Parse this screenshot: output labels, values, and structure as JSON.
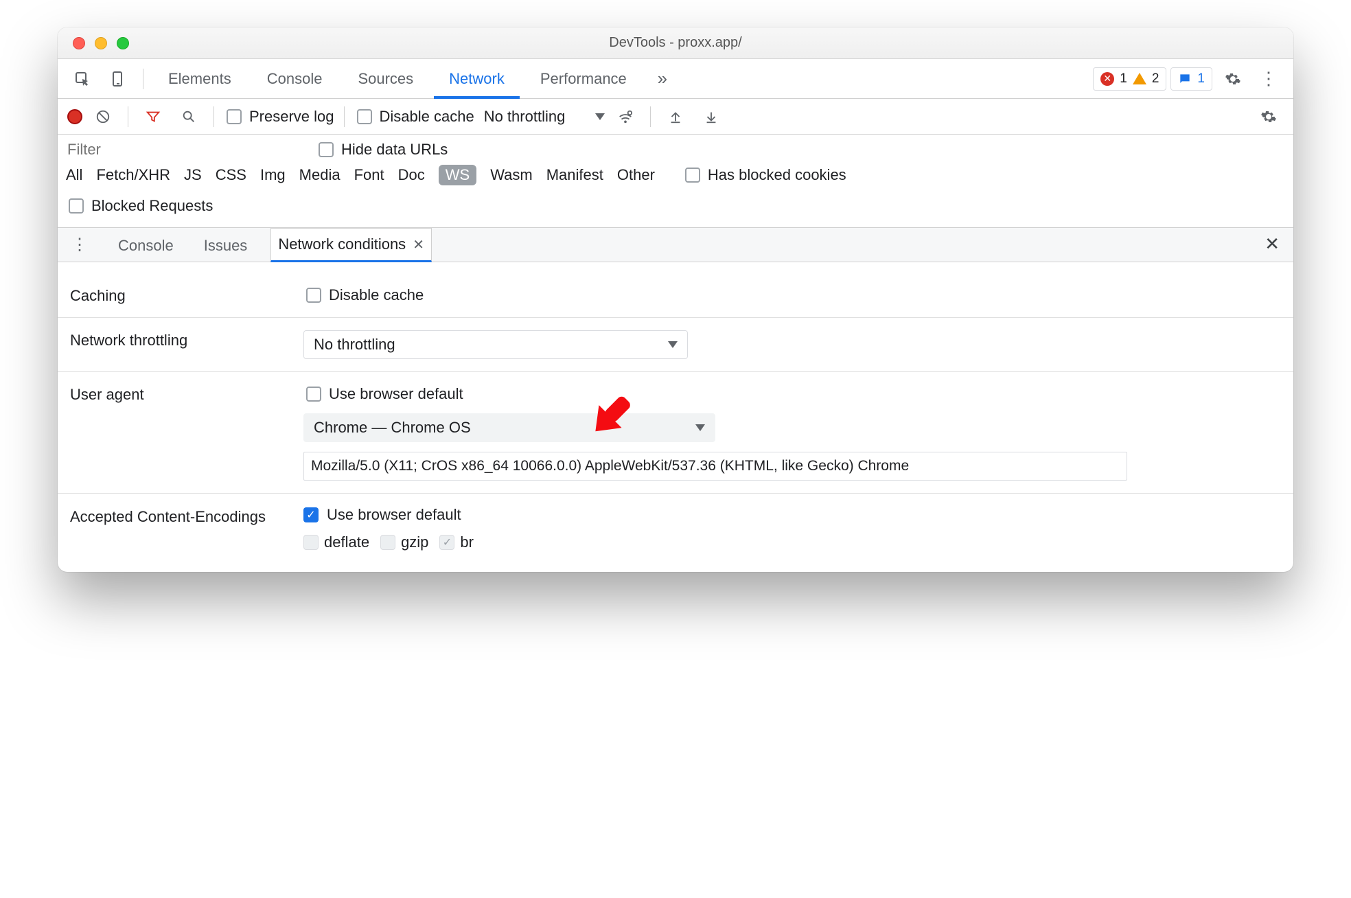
{
  "window": {
    "title": "DevTools - proxx.app/"
  },
  "main_tabs": {
    "items": [
      "Elements",
      "Console",
      "Sources",
      "Network",
      "Performance"
    ],
    "active": "Network",
    "error_count": "1",
    "warn_count": "2",
    "msg_count": "1"
  },
  "net_toolbar": {
    "preserve_log": "Preserve log",
    "disable_cache": "Disable cache",
    "throttling": "No throttling"
  },
  "filter": {
    "placeholder": "Filter",
    "hide_data_urls": "Hide data URLs"
  },
  "types": {
    "items": [
      "All",
      "Fetch/XHR",
      "JS",
      "CSS",
      "Img",
      "Media",
      "Font",
      "Doc",
      "WS",
      "Wasm",
      "Manifest",
      "Other"
    ],
    "selected": "WS",
    "has_blocked": "Has blocked cookies"
  },
  "blocked_requests_label": "Blocked Requests",
  "drawer": {
    "tabs": [
      "Console",
      "Issues",
      "Network conditions"
    ],
    "active": "Network conditions"
  },
  "nc": {
    "caching_label": "Caching",
    "caching_check": "Disable cache",
    "throttling_label": "Network throttling",
    "throttling_value": "No throttling",
    "ua_label": "User agent",
    "ua_default_check": "Use browser default",
    "ua_select": "Chrome — Chrome OS",
    "ua_string": "Mozilla/5.0 (X11; CrOS x86_64 10066.0.0) AppleWebKit/537.36 (KHTML, like Gecko) Chrome",
    "enc_label": "Accepted Content-Encodings",
    "enc_default": "Use browser default",
    "enc_options": [
      "deflate",
      "gzip",
      "br"
    ]
  }
}
